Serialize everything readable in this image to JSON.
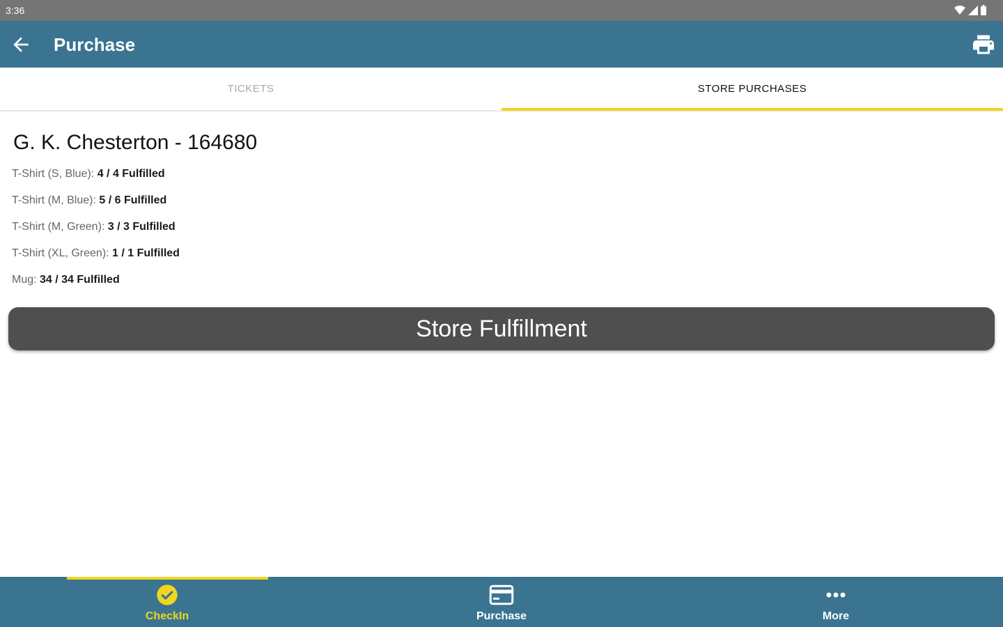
{
  "status_bar": {
    "time": "3:36"
  },
  "app_bar": {
    "title": "Purchase"
  },
  "tabs": [
    {
      "label": "TICKETS",
      "active": false
    },
    {
      "label": "STORE PURCHASES",
      "active": true
    }
  ],
  "customer": {
    "heading": "G. K. Chesterton - 164680"
  },
  "items": [
    {
      "label": "T-Shirt (S, Blue): ",
      "value": "4 / 4 Fulfilled"
    },
    {
      "label": "T-Shirt (M, Blue): ",
      "value": "5 / 6 Fulfilled"
    },
    {
      "label": "T-Shirt (M, Green): ",
      "value": "3 / 3 Fulfilled"
    },
    {
      "label": "T-Shirt (XL, Green): ",
      "value": "1 / 1 Fulfilled"
    },
    {
      "label": "Mug: ",
      "value": "34 / 34 Fulfilled"
    }
  ],
  "fulfill_button": {
    "label": "Store Fulfillment"
  },
  "bottom_nav": [
    {
      "label": "CheckIn",
      "icon": "check-circle-icon",
      "active": true
    },
    {
      "label": "Purchase",
      "icon": "credit-card-icon",
      "active": false
    },
    {
      "label": "More",
      "icon": "more-dots-icon",
      "active": false
    }
  ],
  "colors": {
    "primary": "#3a7490",
    "accent": "#f2d51f",
    "button": "#4f4f4f",
    "status_bar": "#757575"
  }
}
